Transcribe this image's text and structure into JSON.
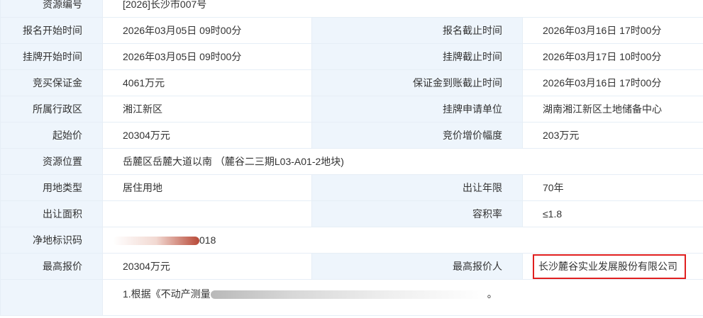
{
  "rows": {
    "resource_no": {
      "label": "资源编号",
      "value": "[2026]长沙市007号"
    },
    "reg_start": {
      "label": "报名开始时间",
      "value": "2026年03月05日 09时00分"
    },
    "reg_end": {
      "label": "报名截止时间",
      "value": "2026年03月16日 17时00分"
    },
    "list_start": {
      "label": "挂牌开始时间",
      "value": "2026年03月05日 09时00分"
    },
    "list_end": {
      "label": "挂牌截止时间",
      "value": "2026年03月17日 10时00分"
    },
    "deposit": {
      "label": "竞买保证金",
      "value": "4061万元"
    },
    "deposit_deadline": {
      "label": "保证金到账截止时间",
      "value": "2026年03月16日 17时00分"
    },
    "district": {
      "label": "所属行政区",
      "value": "湘江新区"
    },
    "applicant": {
      "label": "挂牌申请单位",
      "value": "湖南湘江新区土地储备中心"
    },
    "start_price": {
      "label": "起始价",
      "value": "20304万元"
    },
    "increment": {
      "label": "竞价增价幅度",
      "value": "203万元"
    },
    "location": {
      "label": "资源位置",
      "value": "岳麓区岳麓大道以南 （麓谷二三期L03-A01-2地块)"
    },
    "land_use": {
      "label": "用地类型",
      "value": "居住用地"
    },
    "term": {
      "label": "出让年限",
      "value": "70年"
    },
    "area": {
      "label": "出让面积",
      "value": ""
    },
    "far": {
      "label": "容积率",
      "value": "≤1.8"
    },
    "land_code": {
      "label": "净地标识码",
      "value": "018"
    },
    "top_price": {
      "label": "最高报价",
      "value": "20304万元"
    },
    "top_bidder": {
      "label": "最高报价人",
      "value": "长沙麓谷实业发展股份有限公司"
    }
  },
  "note": {
    "prefix": "1.根据《不动产测量",
    "suffix": "。"
  },
  "colors": {
    "label_bg": "#eef5fc",
    "border": "#e6eef6",
    "highlight": "#e01f1f"
  }
}
